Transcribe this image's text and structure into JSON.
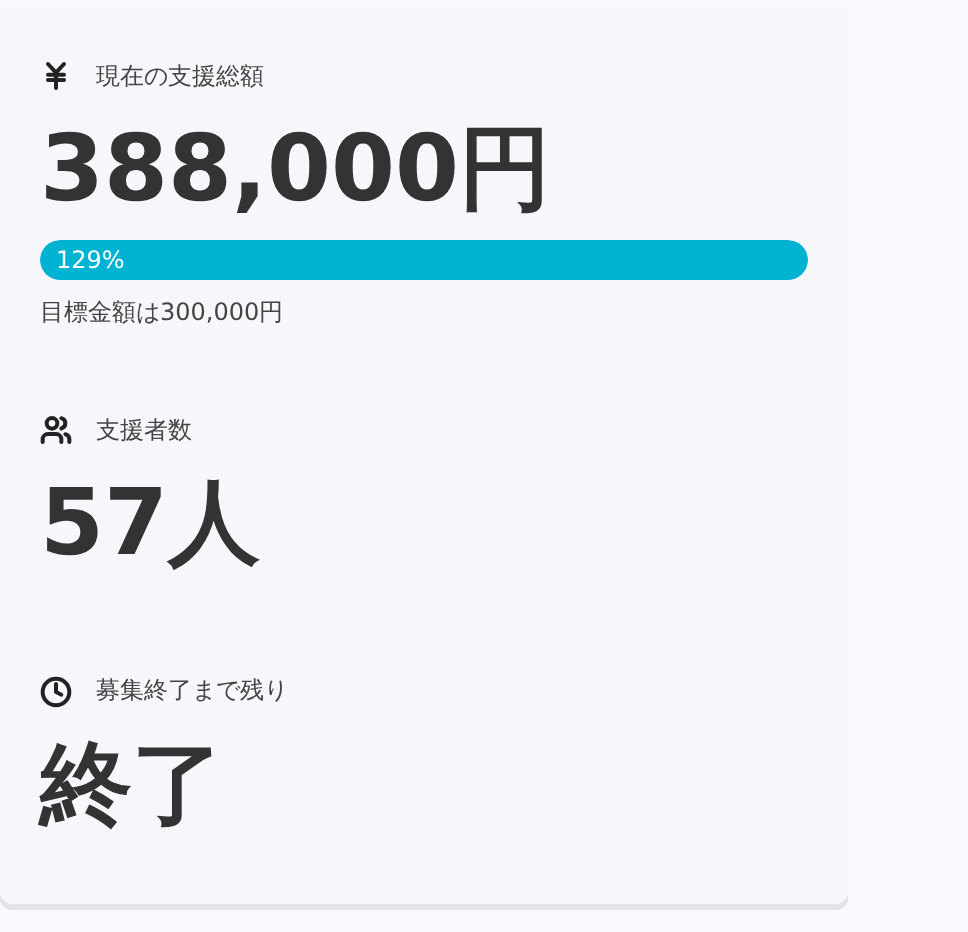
{
  "stats": [
    {
      "kind": "yen",
      "label": "現在の支援総額",
      "value": "388,000円",
      "progress": {
        "level": 1,
        "reading": "129%"
      },
      "note": "目標金額は300,000円"
    },
    {
      "kind": "users",
      "label": "支援者数",
      "value": "57人"
    },
    {
      "kind": "clock",
      "label": "募集終了まで残り",
      "value": "終了"
    }
  ]
}
